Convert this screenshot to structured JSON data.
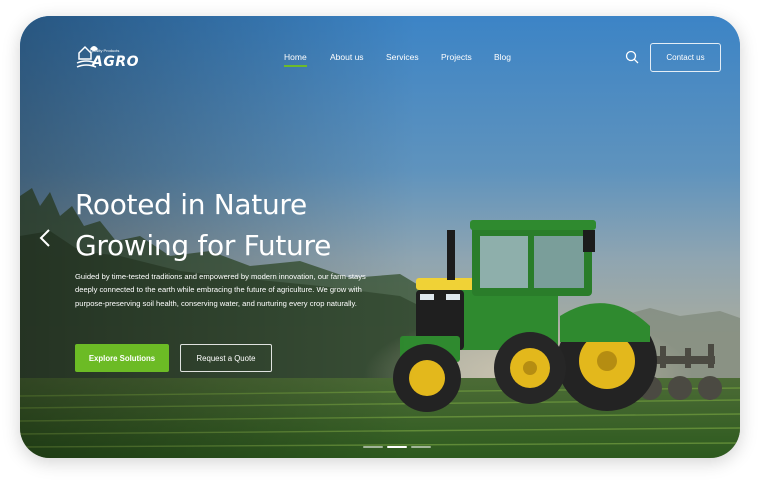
{
  "brand": {
    "name": "AGRO",
    "tagline": "Quality Products"
  },
  "nav": {
    "items": [
      {
        "label": "Home",
        "active": true
      },
      {
        "label": "About us",
        "active": false
      },
      {
        "label": "Services",
        "active": false
      },
      {
        "label": "Projects",
        "active": false
      },
      {
        "label": "Blog",
        "active": false
      }
    ],
    "search_icon": "search-icon",
    "contact_label": "Contact us"
  },
  "hero": {
    "title_line1": "Rooted in Nature",
    "title_line2": "Growing for Future",
    "description": "Guided by time-tested traditions and empowered by modern innovation, our farm stays deeply connected to the earth while embracing the future of agriculture. We grow with purpose-preserving soil health, conserving water, and nurturing every crop naturally.",
    "primary_button": "Explore Solutions",
    "secondary_button": "Request a Quote",
    "prev_icon": "chevron-left-icon"
  },
  "slider": {
    "slide_count": 3,
    "active_index": 1
  },
  "colors": {
    "accent": "#6cbb25",
    "sky": "#3f86c6",
    "tractor_green": "#2f8a2f",
    "wheel_yellow": "#e3b81c"
  }
}
